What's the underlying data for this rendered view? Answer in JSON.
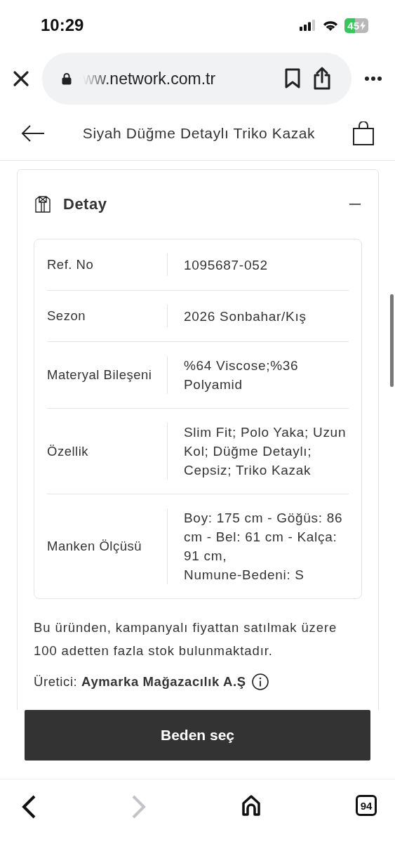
{
  "status_bar": {
    "time": "10:29",
    "battery": "45",
    "charging": true
  },
  "browser": {
    "url": "ww.network.com.tr",
    "secure": true
  },
  "header": {
    "title": "Siyah Düğme Detaylı Triko Kazak"
  },
  "section": {
    "title": "Detay",
    "expanded": true,
    "rows": [
      {
        "label": "Ref. No",
        "value": "1095687-052"
      },
      {
        "label": "Sezon",
        "value": "2026 Sonbahar/Kış"
      },
      {
        "label": "Materyal Bileşeni",
        "value": "%64 Viscose;%36 Polyamid"
      },
      {
        "label": "Özellik",
        "value": "Slim Fit; Polo Yaka; Uzun Kol; Düğme Detaylı; Cepsiz; Triko Kazak"
      },
      {
        "label": "Manken Ölçüsü",
        "value": "Boy: 175 cm - Göğüs: 86 cm - Bel: 61 cm - Kalça: 91 cm,\nNumune-Bedeni: S"
      }
    ],
    "note": "Bu üründen, kampanyalı fiyattan satılmak üzere 100 adetten fazla stok bulunmaktadır.",
    "manufacturer": "Üretici: **Aymarka Mağazacılık A.Ş**"
  },
  "action_button": "Beden seç",
  "toolbar": [
    {
      "kind": "back",
      "disabled": false
    },
    {
      "kind": "forward",
      "disabled": true
    },
    {
      "kind": "home",
      "disabled": false
    },
    {
      "kind": "tabs",
      "disabled": false,
      "count": "94"
    }
  ]
}
